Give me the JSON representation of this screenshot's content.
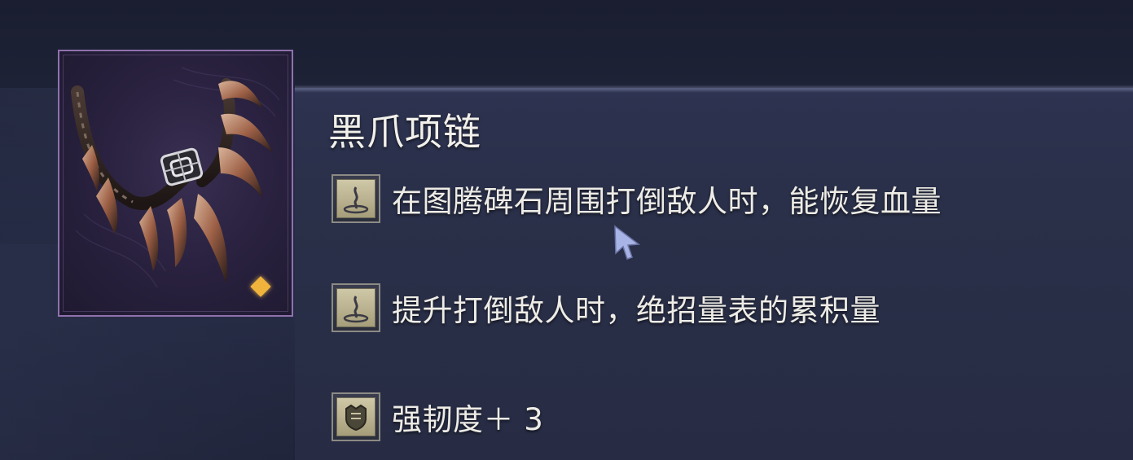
{
  "item": {
    "name": "黑爪项链",
    "icon": "black-claw-necklace-icon",
    "rarity_color": "#f0b43c",
    "frame_color": "#8f72ad"
  },
  "stats": [
    {
      "icon": "totem-effect-icon",
      "text": "在图腾碑石周围打倒敌人时，能恢复血量"
    },
    {
      "icon": "totem-effect-icon",
      "text": "提升打倒敌人时，绝招量表的累积量"
    },
    {
      "icon": "armor-toughness-icon",
      "text": "强韧度＋ 3"
    }
  ]
}
